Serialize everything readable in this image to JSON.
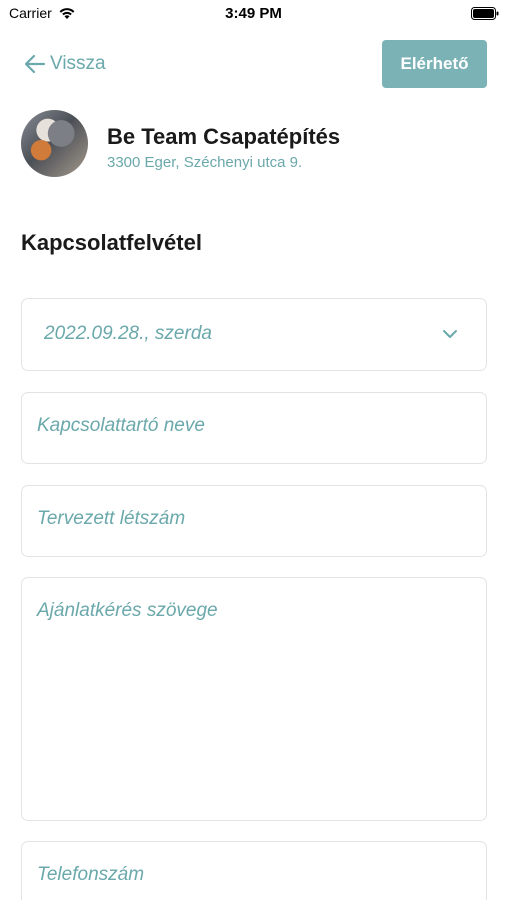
{
  "status_bar": {
    "carrier": "Carrier",
    "time": "3:49 PM"
  },
  "nav": {
    "back_label": "Vissza",
    "available_label": "Elérhető"
  },
  "company": {
    "name": "Be Team Csapatépítés",
    "address": "3300 Eger, Széchenyi utca 9."
  },
  "section_title": "Kapcsolatfelvétel",
  "form": {
    "date_value": "2022.09.28., szerda",
    "contact_name_placeholder": "Kapcsolattartó neve",
    "planned_headcount_placeholder": "Tervezett létszám",
    "request_text_placeholder": "Ajánlatkérés szövege",
    "phone_placeholder": "Telefonszám"
  },
  "colors": {
    "accent": "#6aa8ab",
    "button": "#7ab2b5",
    "border": "#e3e3e3"
  },
  "icons": [
    "wifi-icon",
    "battery-icon",
    "back-arrow-icon",
    "chevron-down-icon"
  ]
}
